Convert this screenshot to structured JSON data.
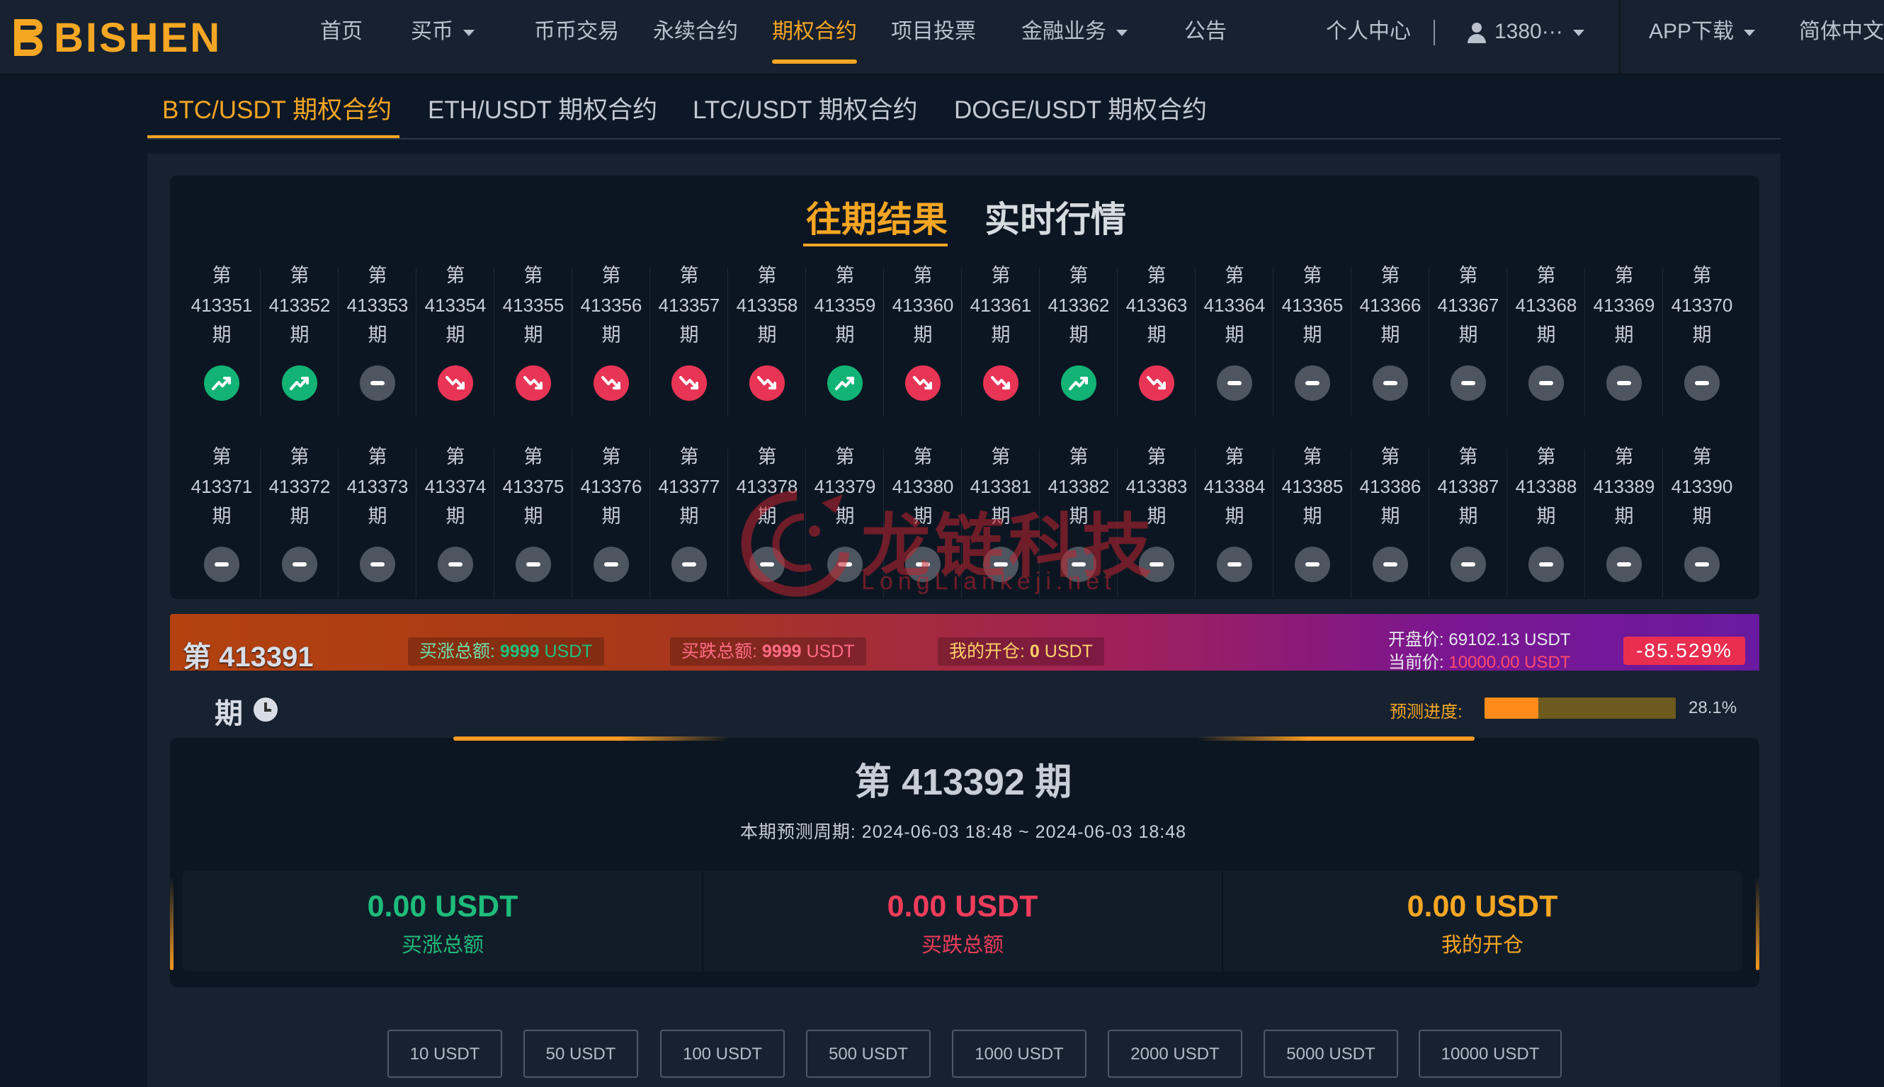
{
  "nav": {
    "logo": "BISHEN",
    "items": [
      {
        "label": "首页"
      },
      {
        "label": "买币"
      },
      {
        "label": "币币交易"
      },
      {
        "label": "永续合约"
      },
      {
        "label": "期权合约"
      },
      {
        "label": "项目投票"
      },
      {
        "label": "金融业务"
      },
      {
        "label": "公告"
      }
    ],
    "personal_center": "个人中心",
    "user": "1380···",
    "app_download": "APP下载",
    "language": "简体中文"
  },
  "pair_tabs": [
    "BTC/USDT 期权合约",
    "ETH/USDT 期权合约",
    "LTC/USDT 期权合约",
    "DOGE/USDT 期权合约"
  ],
  "sub_tabs": [
    "往期结果",
    "实时行情"
  ],
  "period_prefix": "第",
  "period_suffix": "期",
  "periods": [
    {
      "num": "413351",
      "result": "up"
    },
    {
      "num": "413352",
      "result": "up"
    },
    {
      "num": "413353",
      "result": "flat"
    },
    {
      "num": "413354",
      "result": "down"
    },
    {
      "num": "413355",
      "result": "down"
    },
    {
      "num": "413356",
      "result": "down"
    },
    {
      "num": "413357",
      "result": "down"
    },
    {
      "num": "413358",
      "result": "down"
    },
    {
      "num": "413359",
      "result": "up"
    },
    {
      "num": "413360",
      "result": "down"
    },
    {
      "num": "413361",
      "result": "down"
    },
    {
      "num": "413362",
      "result": "up"
    },
    {
      "num": "413363",
      "result": "down"
    },
    {
      "num": "413364",
      "result": "flat"
    },
    {
      "num": "413365",
      "result": "flat"
    },
    {
      "num": "413366",
      "result": "flat"
    },
    {
      "num": "413367",
      "result": "flat"
    },
    {
      "num": "413368",
      "result": "flat"
    },
    {
      "num": "413369",
      "result": "flat"
    },
    {
      "num": "413370",
      "result": "flat"
    },
    {
      "num": "413371",
      "result": "flat"
    },
    {
      "num": "413372",
      "result": "flat"
    },
    {
      "num": "413373",
      "result": "flat"
    },
    {
      "num": "413374",
      "result": "flat"
    },
    {
      "num": "413375",
      "result": "flat"
    },
    {
      "num": "413376",
      "result": "flat"
    },
    {
      "num": "413377",
      "result": "flat"
    },
    {
      "num": "413378",
      "result": "flat"
    },
    {
      "num": "413379",
      "result": "flat"
    },
    {
      "num": "413380",
      "result": "flat"
    },
    {
      "num": "413381",
      "result": "flat"
    },
    {
      "num": "413382",
      "result": "flat"
    },
    {
      "num": "413383",
      "result": "flat"
    },
    {
      "num": "413384",
      "result": "flat"
    },
    {
      "num": "413385",
      "result": "flat"
    },
    {
      "num": "413386",
      "result": "flat"
    },
    {
      "num": "413387",
      "result": "flat"
    },
    {
      "num": "413388",
      "result": "flat"
    },
    {
      "num": "413389",
      "result": "flat"
    },
    {
      "num": "413390",
      "result": "flat"
    }
  ],
  "watermark": {
    "text": "龙链科技",
    "sub": "LongLiankeji.net"
  },
  "current_round": {
    "number": "第 413391",
    "suffix": "期",
    "buy_up_label": "买涨总额:",
    "buy_up_value": "9999",
    "buy_down_label": "买跌总额:",
    "buy_down_value": "9999",
    "mine_label": "我的开仓:",
    "mine_value": "0",
    "unit": "USDT",
    "open_price_label": "开盘价:",
    "open_price": "69102.13 USDT",
    "current_price_label": "当前价:",
    "current_price": "10000.00 USDT",
    "change_pct": "-85.529%",
    "progress_label": "预测进度:",
    "progress_value": "28.1%",
    "progress_fraction": 0.281
  },
  "next_round": {
    "title": "第 413392 期",
    "period_text": "本期预测周期: 2024-06-03 18:48 ~ 2024-06-03 18:48",
    "stats": [
      {
        "value": "0.00 USDT",
        "label": "买涨总额"
      },
      {
        "value": "0.00 USDT",
        "label": "买跌总额"
      },
      {
        "value": "0.00 USDT",
        "label": "我的开仓"
      }
    ]
  },
  "amounts": [
    "10 USDT",
    "50 USDT",
    "100 USDT",
    "500 USDT",
    "1000 USDT",
    "2000 USDT",
    "5000 USDT",
    "10000 USDT"
  ],
  "colors": {
    "accent": "#f5a623",
    "up": "#12b374",
    "down": "#e83556",
    "flat": "#4d5560"
  },
  "icons": {
    "up": "trend-up-icon",
    "down": "trend-down-icon",
    "flat": "minus-icon"
  }
}
